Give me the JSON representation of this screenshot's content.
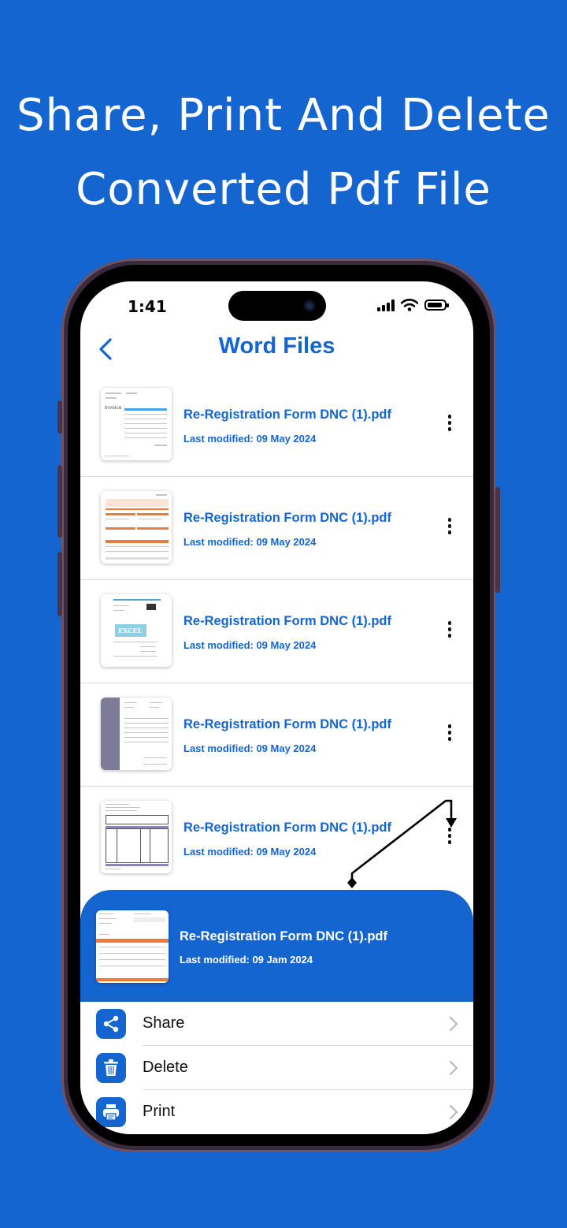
{
  "headline": {
    "line1": "Share, Print And Delete",
    "line2": "Converted Pdf File"
  },
  "status_bar": {
    "time": "1:41"
  },
  "nav": {
    "title": "Word Files"
  },
  "files": [
    {
      "name": "Re-Registration Form  DNC (1).pdf",
      "date": "Last modified: 09 May 2024"
    },
    {
      "name": "Re-Registration Form  DNC (1).pdf",
      "date": "Last modified: 09 May 2024"
    },
    {
      "name": "Re-Registration Form  DNC (1).pdf",
      "date": "Last modified: 09 May 2024"
    },
    {
      "name": "Re-Registration Form  DNC (1).pdf",
      "date": "Last modified: 09 May 2024"
    },
    {
      "name": "Re-Registration Form  DNC (1).pdf",
      "date": "Last modified: 09 May 2024"
    }
  ],
  "thumb_texts": {
    "invoice": "Invoice",
    "excel": "EXCEL"
  },
  "sheet": {
    "name": "Re-Registration Form  DNC (1).pdf",
    "date": "Last modified: 09 Jam 2024",
    "actions": [
      {
        "label": "Share",
        "icon": "share-icon"
      },
      {
        "label": "Delete",
        "icon": "trash-icon"
      },
      {
        "label": "Print",
        "icon": "printer-icon"
      }
    ]
  },
  "colors": {
    "brand": "#1565D0",
    "background": "#1565D0"
  }
}
